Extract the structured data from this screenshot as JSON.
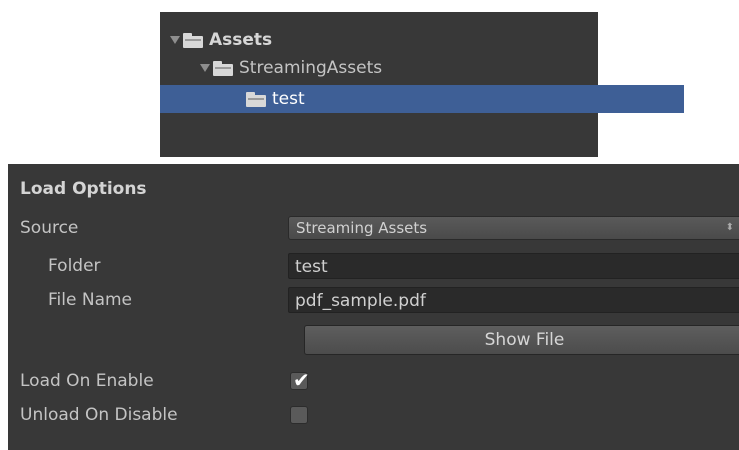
{
  "tree": {
    "items": [
      {
        "label": "Assets",
        "expanded": true,
        "selected": false,
        "bold": true
      },
      {
        "label": "StreamingAssets",
        "expanded": true,
        "selected": false,
        "bold": false
      },
      {
        "label": "test",
        "expanded": false,
        "selected": true,
        "bold": false
      }
    ]
  },
  "inspector": {
    "header": "Load Options",
    "source": {
      "label": "Source",
      "value": "Streaming Assets",
      "arrows": "⬍"
    },
    "folder": {
      "label": "Folder",
      "value": "test"
    },
    "file_name": {
      "label": "File Name",
      "value": "pdf_sample.pdf"
    },
    "show_file_label": "Show File",
    "load_on_enable": {
      "label": "Load On Enable",
      "checked": true,
      "mark": "✔"
    },
    "unload_on_disable": {
      "label": "Unload On Disable",
      "checked": false
    }
  },
  "colors": {
    "panel_bg": "#383838",
    "selection": "#3e5f96",
    "field_bg": "#2a2a2a"
  }
}
